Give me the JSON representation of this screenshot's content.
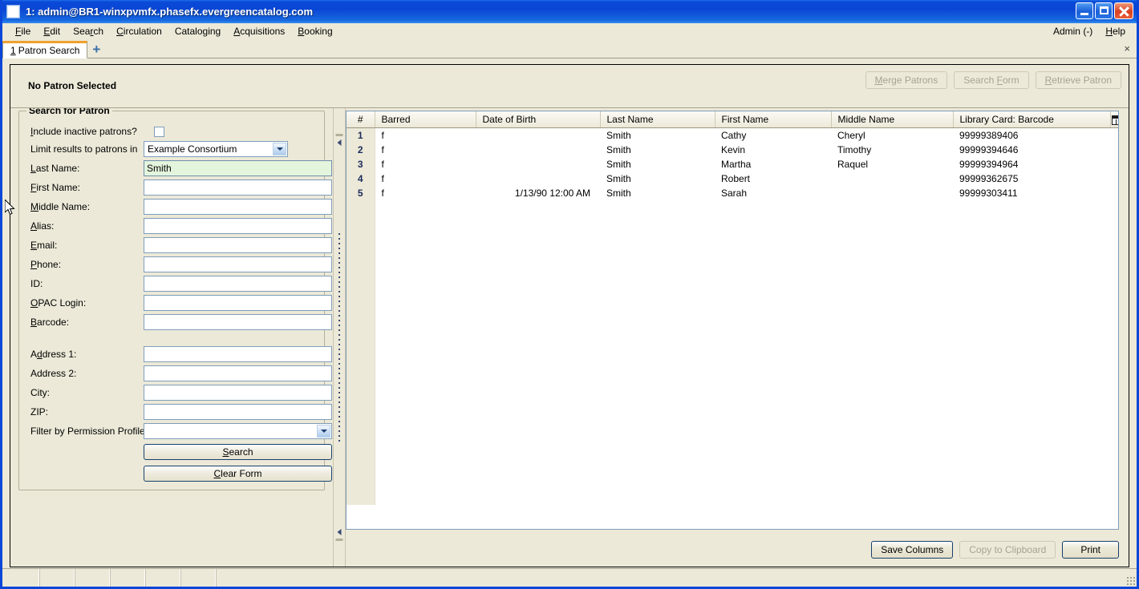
{
  "window": {
    "title": "1: admin@BR1-winxpvmfx.phasefx.evergreencatalog.com",
    "minimize_label": "Minimize",
    "maximize_label": "Maximize",
    "close_label": "Close"
  },
  "menubar": {
    "items": [
      {
        "label": "File",
        "accel": "F"
      },
      {
        "label": "Edit",
        "accel": "E"
      },
      {
        "label": "Search",
        "accel": "r"
      },
      {
        "label": "Circulation",
        "accel": "C"
      },
      {
        "label": "Cataloging",
        "accel": "g"
      },
      {
        "label": "Acquisitions",
        "accel": "A"
      },
      {
        "label": "Booking",
        "accel": "B"
      }
    ],
    "right": [
      {
        "label": "Admin (-)",
        "accel": ""
      },
      {
        "label": "Help",
        "accel": "H"
      }
    ]
  },
  "tabs": {
    "items": [
      {
        "number": "1",
        "label": "Patron Search"
      }
    ],
    "new_tab_label": "+",
    "close_label": "×"
  },
  "patron_bar": {
    "status": "No Patron Selected",
    "buttons": [
      {
        "name": "merge-patrons-button",
        "label": "Merge Patrons",
        "accel": "M",
        "enabled": false
      },
      {
        "name": "search-form-button",
        "label": "Search Form",
        "accel": "F",
        "enabled": false
      },
      {
        "name": "retrieve-patron-button",
        "label": "Retrieve Patron",
        "accel": "R",
        "enabled": false
      }
    ]
  },
  "search_form": {
    "legend": "Search for Patron",
    "include_inactive": {
      "label": "Include inactive patrons?",
      "accel": "I",
      "checked": false
    },
    "limit_results": {
      "label": "Limit results to patrons in",
      "value": "Example Consortium"
    },
    "fields": [
      {
        "name": "last-name",
        "label": "Last Name:",
        "accel": "L",
        "value": "Smith",
        "placeholder": "",
        "focused": true
      },
      {
        "name": "first-name",
        "label": "First Name:",
        "accel": "F",
        "value": "",
        "placeholder": "",
        "focused": false
      },
      {
        "name": "middle-name",
        "label": "Middle Name:",
        "accel": "M",
        "value": "",
        "placeholder": "",
        "focused": false
      },
      {
        "name": "alias",
        "label": "Alias:",
        "accel": "A",
        "value": "",
        "placeholder": "",
        "focused": false
      },
      {
        "name": "email",
        "label": "Email:",
        "accel": "E",
        "value": "",
        "placeholder": "",
        "focused": false
      },
      {
        "name": "phone",
        "label": "Phone:",
        "accel": "P",
        "value": "",
        "placeholder": "",
        "focused": false
      },
      {
        "name": "id",
        "label": "ID:",
        "accel": "",
        "value": "",
        "placeholder": "",
        "focused": false
      },
      {
        "name": "opac-login",
        "label": "OPAC Login:",
        "accel": "O",
        "value": "",
        "placeholder": "",
        "focused": false
      },
      {
        "name": "barcode",
        "label": "Barcode:",
        "accel": "B",
        "value": "",
        "placeholder": "",
        "focused": false
      },
      {
        "name": "address-1",
        "label": "Address 1:",
        "accel": "d",
        "value": "",
        "placeholder": "",
        "focused": false
      },
      {
        "name": "address-2",
        "label": "Address 2:",
        "accel": "",
        "value": "",
        "placeholder": "",
        "focused": false
      },
      {
        "name": "city",
        "label": "City:",
        "accel": "",
        "value": "",
        "placeholder": "",
        "focused": false
      },
      {
        "name": "zip",
        "label": "ZIP:",
        "accel": "",
        "value": "",
        "placeholder": "",
        "focused": false
      }
    ],
    "permission_profile": {
      "label": "Filter by Permission Profile:",
      "value": ""
    },
    "search_button": {
      "label": "Search",
      "accel": "S"
    },
    "clear_button": {
      "label": "Clear Form",
      "accel": "C"
    }
  },
  "results": {
    "columns": [
      {
        "key": "num",
        "label": "#"
      },
      {
        "key": "barred",
        "label": "Barred"
      },
      {
        "key": "dob",
        "label": "Date of Birth"
      },
      {
        "key": "last",
        "label": "Last Name"
      },
      {
        "key": "first",
        "label": "First Name"
      },
      {
        "key": "middle",
        "label": "Middle Name"
      },
      {
        "key": "barcode",
        "label": "Library Card: Barcode"
      }
    ],
    "column_picker_label": "Column picker",
    "rows": [
      {
        "num": "1",
        "barred": "f",
        "dob": "",
        "last": "Smith",
        "first": "Cathy",
        "middle": "Cheryl",
        "barcode": "99999389406"
      },
      {
        "num": "2",
        "barred": "f",
        "dob": "",
        "last": "Smith",
        "first": "Kevin",
        "middle": "Timothy",
        "barcode": "99999394646"
      },
      {
        "num": "3",
        "barred": "f",
        "dob": "",
        "last": "Smith",
        "first": "Martha",
        "middle": "Raquel",
        "barcode": "99999394964"
      },
      {
        "num": "4",
        "barred": "f",
        "dob": "",
        "last": "Smith",
        "first": "Robert",
        "middle": "",
        "barcode": "99999362675"
      },
      {
        "num": "5",
        "barred": "f",
        "dob": "1/13/90 12:00 AM",
        "last": "Smith",
        "first": "Sarah",
        "middle": "",
        "barcode": "99999303411"
      }
    ],
    "buttons": [
      {
        "name": "save-columns-button",
        "label": "Save Columns",
        "enabled": true
      },
      {
        "name": "copy-to-clipboard-button",
        "label": "Copy to Clipboard",
        "enabled": false
      },
      {
        "name": "print-button",
        "label": "Print",
        "enabled": true
      }
    ]
  },
  "colors": {
    "window_chrome": "#ece9d8",
    "title_blue": "#0a46d4",
    "tab_accent": "#f0a030",
    "focused_field": "#e4f5dd",
    "row_number": "#1b2a5a"
  }
}
